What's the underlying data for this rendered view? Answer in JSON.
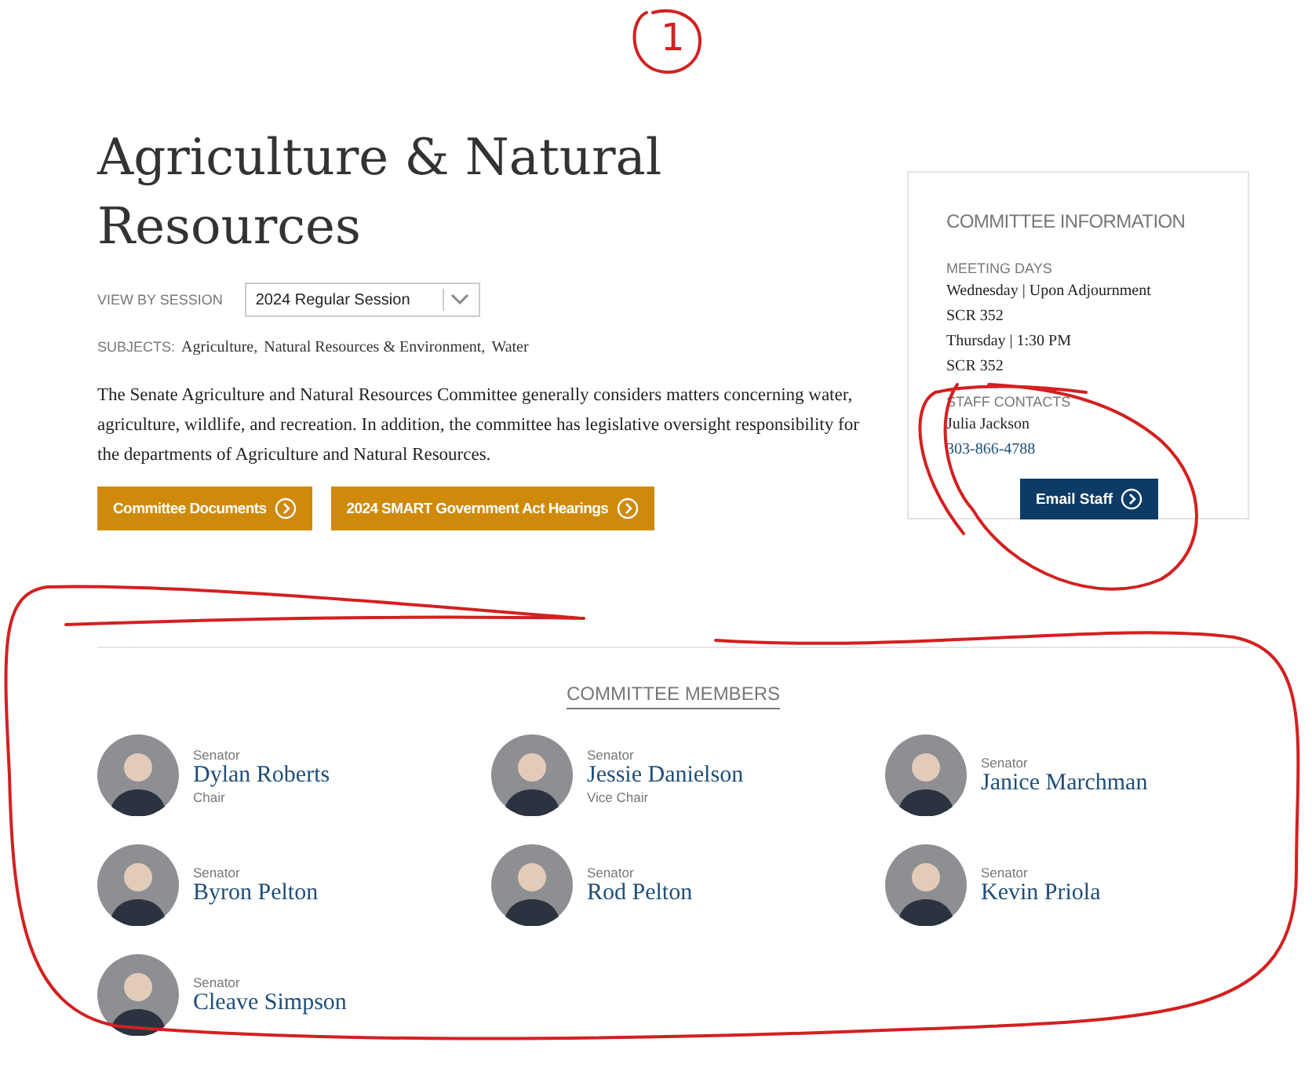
{
  "annotation": {
    "label": "1"
  },
  "title": "Agriculture & Natural Resources",
  "session": {
    "label": "VIEW BY SESSION",
    "value": "2024 Regular Session"
  },
  "subjects": {
    "label": "SUBJECTS:",
    "items": [
      "Agriculture,",
      "Natural Resources & Environment,",
      "Water"
    ]
  },
  "description": "The Senate Agriculture and Natural Resources Committee generally considers matters concerning water, agriculture, wildlife, and recreation.  In addition, the committee has legislative oversight responsibility for the departments of Agriculture and Natural Resources.",
  "buttons": [
    "Committee Documents",
    "2024 SMART Government Act Hearings"
  ],
  "committee_information": {
    "heading": "COMMITTEE INFORMATION",
    "meeting_days": {
      "label": "MEETING DAYS",
      "lines": [
        "Wednesday | Upon Adjournment",
        "SCR 352",
        "Thursday | 1:30 PM",
        "SCR 352"
      ]
    },
    "staff_contacts": {
      "label": "STAFF CONTACTS",
      "name": "Julia Jackson",
      "phone": "303-866-4788"
    },
    "button": "Email Staff"
  },
  "members": {
    "heading": "COMMITTEE MEMBERS",
    "items": [
      {
        "title": "Senator",
        "name": "Dylan Roberts",
        "role": "Chair"
      },
      {
        "title": "Senator",
        "name": "Jessie Danielson",
        "role": "Vice Chair"
      },
      {
        "title": "Senator",
        "name": "Janice Marchman"
      },
      {
        "title": "Senator",
        "name": "Byron Pelton"
      },
      {
        "title": "Senator",
        "name": "Rod Pelton"
      },
      {
        "title": "Senator",
        "name": "Kevin Priola"
      },
      {
        "title": "Senator",
        "name": "Cleave Simpson"
      }
    ]
  }
}
